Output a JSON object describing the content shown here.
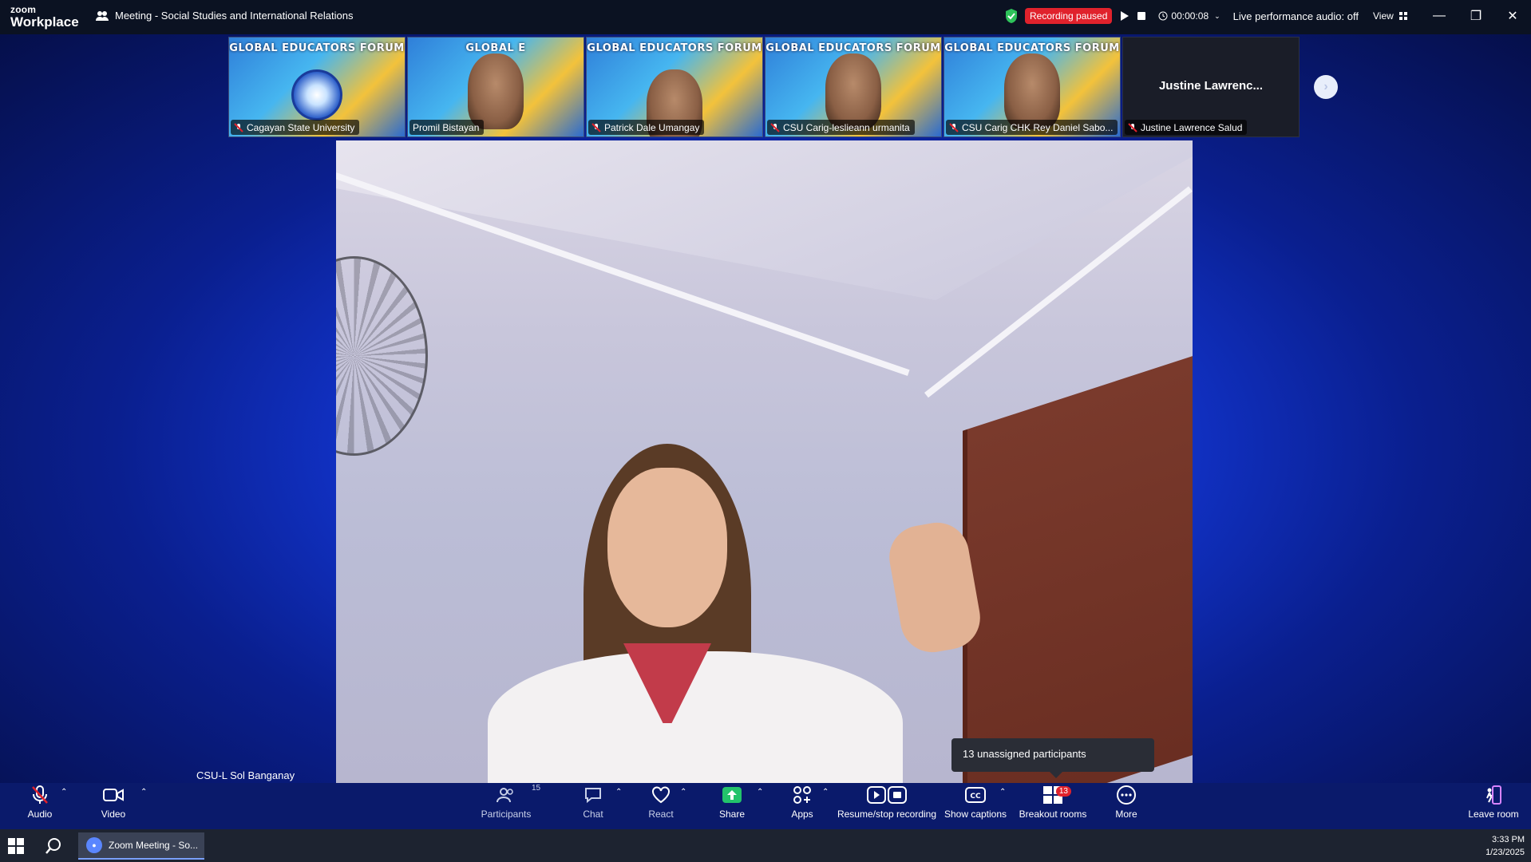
{
  "app": {
    "logo_top": "zoom",
    "logo_bottom": "Workplace",
    "meeting_title": "Meeting - Social Studies and International Relations",
    "recording_status": "Recording paused",
    "timer": "00:00:08",
    "live_audio": "Live performance audio: off",
    "view_label": "View"
  },
  "thumbnails": [
    {
      "name": "Cagayan State University",
      "banner": "GLOBAL EDUCATORS FORUM",
      "kind": "seal"
    },
    {
      "name": "Promil Bistayan",
      "banner": "GLOBAL E",
      "kind": "face"
    },
    {
      "name": "Patrick Dale Umangay",
      "banner": "GLOBAL EDUCATORS FORUM",
      "kind": "face"
    },
    {
      "name": "CSU Carig-leslieann urmanita",
      "banner": "GLOBAL EDUCATORS FORUM",
      "kind": "face"
    },
    {
      "name": "CSU Carig CHK Rey Daniel Sabo...",
      "banner": "GLOBAL EDUCATORS FORUM",
      "kind": "face"
    }
  ],
  "dark_thumb": {
    "big_name": "Justine  Lawrenc...",
    "name": "Justine Lawrence Salud"
  },
  "main_speaker": "CSU-L Sol Banganay",
  "tooltip": "13 unassigned participants",
  "toolbar": {
    "audio": "Audio",
    "video": "Video",
    "participants": "Participants",
    "participants_count": "15",
    "chat": "Chat",
    "react": "React",
    "share": "Share",
    "apps": "Apps",
    "recording": "Resume/stop recording",
    "captions": "Show captions",
    "breakout": "Breakout rooms",
    "breakout_badge": "13",
    "more": "More",
    "leave": "Leave room"
  },
  "taskbar": {
    "app_label": "Zoom Meeting - So...",
    "time": "3:33 PM",
    "date": "1/23/2025"
  },
  "colors": {
    "accent_red": "#e0222c",
    "share_green": "#23c36b",
    "shield_green": "#2ec25a"
  }
}
